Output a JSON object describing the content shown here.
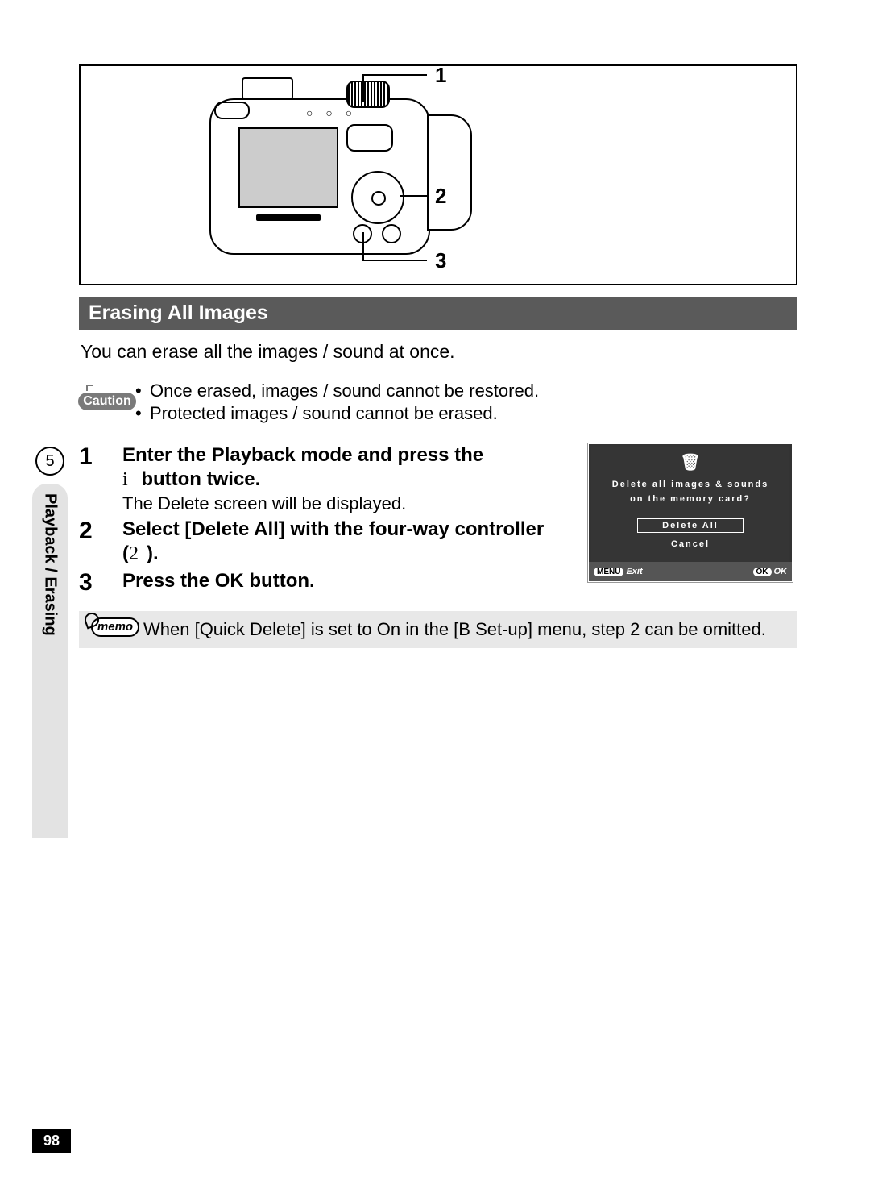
{
  "page_number": "98",
  "section_tab": {
    "number": "5",
    "label": "Playback / Erasing"
  },
  "figure": {
    "callouts": [
      "1",
      "2",
      "3"
    ],
    "cam_dots": "○ ○ ○"
  },
  "section_title": "Erasing All Images",
  "intro": "You can erase all the images / sound at once.",
  "caution": {
    "label": "Caution",
    "items": [
      "Once erased, images / sound cannot be restored.",
      "Protected images / sound cannot be erased."
    ]
  },
  "steps": [
    {
      "num": "1",
      "title_pre": "Enter the Playback mode and press the ",
      "title_glyph": "i",
      "title_post": " button twice.",
      "sub": "The Delete screen will be displayed."
    },
    {
      "num": "2",
      "title_pre": "Select [Delete All] with the four-way controller (",
      "title_glyph": "2",
      "title_post": ").",
      "sub": ""
    },
    {
      "num": "3",
      "title_pre": "Press the OK button.",
      "title_glyph": "",
      "title_post": "",
      "sub": ""
    }
  ],
  "lcd": {
    "trash_icon": "🗑",
    "line1": "Delete all images & sounds",
    "line2": "on the memory card?",
    "option_selected": "Delete All",
    "option_cancel": "Cancel",
    "left_chip": "MENU",
    "left_label": "Exit",
    "right_chip": "OK",
    "right_label": "OK"
  },
  "memo": {
    "label": "memo",
    "text": "When [Quick Delete] is set to On in the [B  Set-up] menu, step 2 can be omitted."
  }
}
